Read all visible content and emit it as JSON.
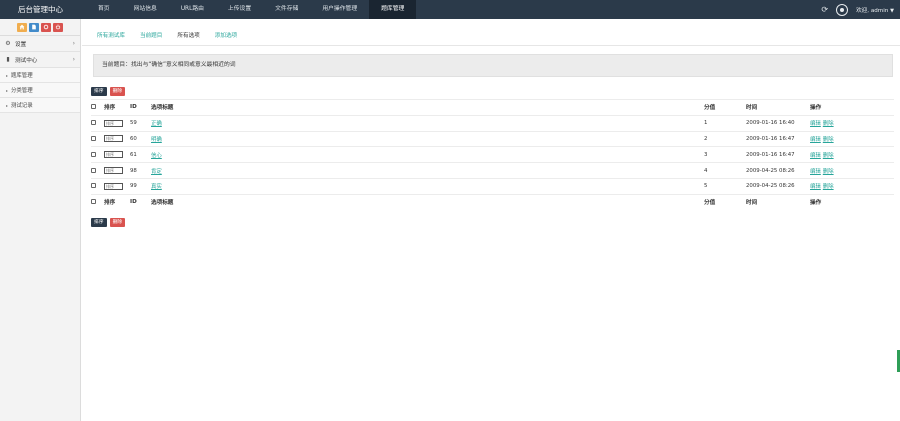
{
  "app": {
    "title": "后台管理中心"
  },
  "topnav": {
    "items": [
      "首页",
      "网站信息",
      "URL路由",
      "上传设置",
      "文件存储",
      "用户操作管理",
      "题库管理"
    ],
    "active_index": 6
  },
  "topright": {
    "user_label": "欢迎, admin"
  },
  "sidebar": {
    "shortcut_icons": [
      "home-icon",
      "file-icon",
      "refresh-icon",
      "power-icon"
    ],
    "shortcut_colors": [
      "#f0ad4e",
      "#428bca",
      "#d9534f",
      "#d9534f"
    ],
    "menu": [
      {
        "label": "设置",
        "icon": "gear-icon",
        "expandable": true
      },
      {
        "label": "测试中心",
        "icon": "book-icon",
        "expandable": true
      }
    ],
    "submenu": [
      "题库管理",
      "分类管理",
      "测试记录"
    ]
  },
  "main": {
    "tabs": [
      "所有测试库",
      "当前题目",
      "所有选项",
      "添加选项"
    ],
    "active_tab_index": 2,
    "question": "当前题目：找出与“确信”意义相同或意义最相近的词",
    "buttons": {
      "sort": "排序",
      "delete": "删除"
    },
    "columns": [
      "",
      "排序",
      "ID",
      "选项标题",
      "分值",
      "时间",
      "操作"
    ],
    "rows": [
      {
        "sort_placeholder": "排序",
        "id": "59",
        "title": "正确",
        "score": "1",
        "time": "2009-01-16 16:40",
        "ops": [
          "编辑",
          "删除"
        ]
      },
      {
        "sort_placeholder": "排序",
        "id": "60",
        "title": "明确",
        "score": "2",
        "time": "2009-01-16 16:47",
        "ops": [
          "编辑",
          "删除"
        ]
      },
      {
        "sort_placeholder": "排序",
        "id": "61",
        "title": "信心",
        "score": "3",
        "time": "2009-01-16 16:47",
        "ops": [
          "编辑",
          "删除"
        ]
      },
      {
        "sort_placeholder": "排序",
        "id": "98",
        "title": "肯定",
        "score": "4",
        "time": "2009-04-25 08:26",
        "ops": [
          "编辑",
          "删除"
        ]
      },
      {
        "sort_placeholder": "排序",
        "id": "99",
        "title": "真实",
        "score": "5",
        "time": "2009-04-25 08:26",
        "ops": [
          "编辑",
          "删除"
        ]
      }
    ]
  },
  "colors": {
    "topbar": "#2b3a4a",
    "accent": "#27a59a",
    "danger": "#d9534f"
  }
}
